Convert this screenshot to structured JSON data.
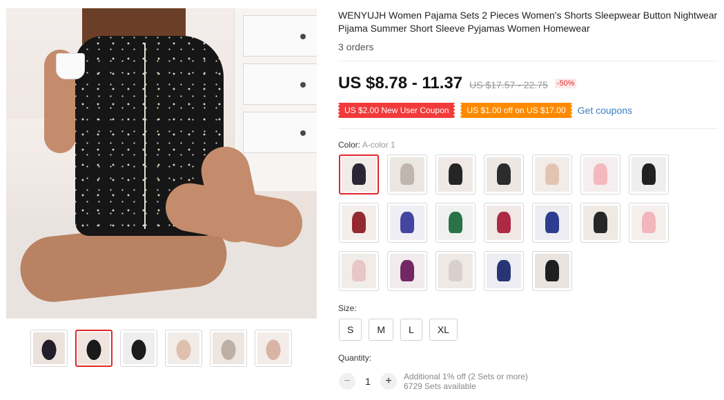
{
  "product": {
    "title": "WENYUJH Women Pajama Sets 2 Pieces Women's Shorts Sleepwear Button Nightwear Pijama Summer Short Sleeve Pyjamas Women Homewear",
    "orders": "3 orders"
  },
  "price": {
    "current": "US $8.78 - 11.37",
    "original": "US $17.57 - 22.75",
    "discount": "-50%"
  },
  "coupons": {
    "new_user": "US $2.00 New User Coupon",
    "store": "US $1.00 off on US $17.00",
    "get_link": "Get coupons"
  },
  "color": {
    "label": "Color:",
    "selected": "A-color 1"
  },
  "swatches": [
    {
      "c": "#1f1b2a",
      "bg": "#f2ece8"
    },
    {
      "c": "#bfb3aa",
      "bg": "#ece6e1"
    },
    {
      "c": "#1a1a1a",
      "bg": "#efe8e6"
    },
    {
      "c": "#222222",
      "bg": "#ece7e2"
    },
    {
      "c": "#e2c2b0",
      "bg": "#f1ece8"
    },
    {
      "c": "#f3b4bb",
      "bg": "#f5eeee"
    },
    {
      "c": "#151515",
      "bg": "#eeeeee"
    },
    {
      "c": "#8e1f25",
      "bg": "#f3eeec"
    },
    {
      "c": "#3a3a9e",
      "bg": "#eeeef4"
    },
    {
      "c": "#1f6a3e",
      "bg": "#eef1ee"
    },
    {
      "c": "#a8203a",
      "bg": "#f0e8e6"
    },
    {
      "c": "#23358a",
      "bg": "#ecedf1"
    },
    {
      "c": "#1c1c1c",
      "bg": "#efe9e4"
    },
    {
      "c": "#f1b2b9",
      "bg": "#f5efee"
    },
    {
      "c": "#e7c4c4",
      "bg": "#f0ece8"
    },
    {
      "c": "#6b1e5c",
      "bg": "#f1ebeb"
    },
    {
      "c": "#d7cfc9",
      "bg": "#efe9e6"
    },
    {
      "c": "#1e2b6e",
      "bg": "#ecedf2"
    },
    {
      "c": "#141414",
      "bg": "#e9e4df"
    }
  ],
  "thumbnails": [
    {
      "c": "#241d2c",
      "bg": "#ece2dc"
    },
    {
      "c": "#1a1a1a",
      "bg": "#f0e4de"
    },
    {
      "c": "#1b1b1b",
      "bg": "#eeeeee"
    },
    {
      "c": "#dfc0ae",
      "bg": "#f2ece8"
    },
    {
      "c": "#bdb1a7",
      "bg": "#ede6e1"
    },
    {
      "c": "#d9b3a6",
      "bg": "#f3ece8"
    }
  ],
  "size": {
    "label": "Size:",
    "options": [
      "S",
      "M",
      "L",
      "XL"
    ]
  },
  "quantity": {
    "label": "Quantity:",
    "value": "1",
    "minus": "−",
    "plus": "+",
    "offer": "Additional 1% off (2 Sets or more)",
    "available": "6729 Sets available"
  }
}
